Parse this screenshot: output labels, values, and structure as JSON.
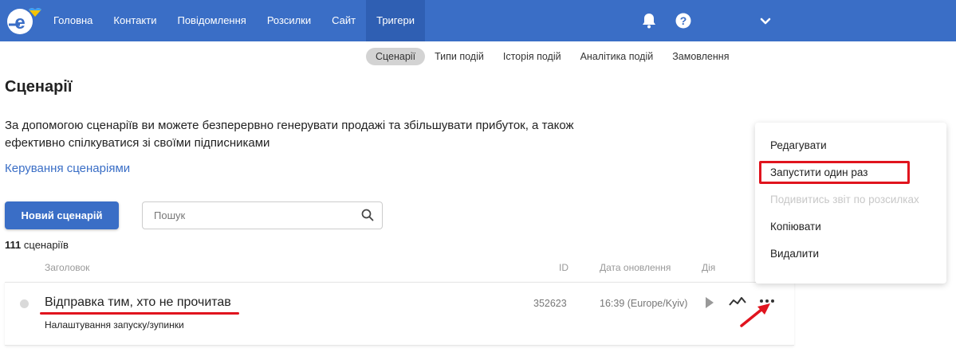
{
  "nav": {
    "items": [
      {
        "label": "Головна"
      },
      {
        "label": "Контакти"
      },
      {
        "label": "Повідомлення"
      },
      {
        "label": "Розсилки"
      },
      {
        "label": "Сайт"
      },
      {
        "label": "Тригери"
      }
    ],
    "active": "Тригери",
    "icons": [
      "bell-icon",
      "help-icon",
      "chevron-down-icon"
    ],
    "accent_color": "#3a6ec6"
  },
  "subnav": {
    "items": [
      {
        "label": "Сценарії"
      },
      {
        "label": "Типи подій"
      },
      {
        "label": "Історія подій"
      },
      {
        "label": "Аналітика подій"
      },
      {
        "label": "Замовлення"
      }
    ],
    "active": "Сценарії"
  },
  "page": {
    "title": "Сценарії",
    "description_line1": "За допомогою сценаріїв ви можете безперервно генерувати продажі та збільшувати прибуток, а також",
    "description_line2": "ефективно спілкуватися зі своїми підписниками",
    "manage_link": "Керування сценаріями"
  },
  "toolbar": {
    "new_button": "Новий сценарій",
    "search_placeholder": "Пошук"
  },
  "count": {
    "number": "111",
    "label": "сценаріїв"
  },
  "table": {
    "columns": [
      "Заголовок",
      "ID",
      "Дата оновлення",
      "Дія"
    ],
    "rows": [
      {
        "title": "Відправка тим, хто не прочитав",
        "subtitle": "Налаштування запуску/зупинки",
        "id": "352623",
        "date": "16:39 (Europe/Kyiv)"
      }
    ]
  },
  "menu": {
    "items": [
      {
        "label": "Редагувати",
        "disabled": false
      },
      {
        "label": "Запустити один раз",
        "disabled": false
      },
      {
        "label": "Подивитись звіт по розсилках",
        "disabled": true
      },
      {
        "label": "Копіювати",
        "disabled": false
      },
      {
        "label": "Видалити",
        "disabled": false
      }
    ],
    "highlight_color": "#e0141e"
  }
}
